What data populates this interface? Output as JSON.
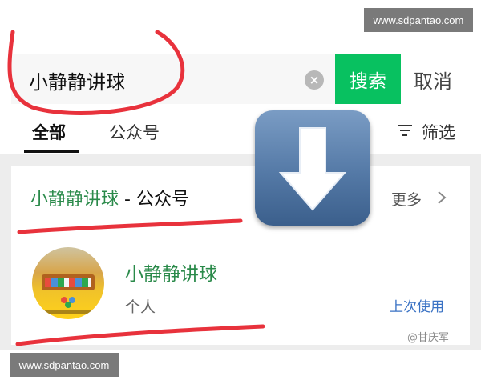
{
  "watermark": {
    "site": "www.sdpantao.com"
  },
  "search": {
    "query": "小静静讲球",
    "clear_glyph": "×",
    "button_label": "搜索",
    "cancel_label": "取消"
  },
  "tabs": {
    "all": "全部",
    "official": "公众号",
    "filter": "筛选"
  },
  "section": {
    "title_highlight": "小静静讲球",
    "title_rest": " - 公众号",
    "more": "更多"
  },
  "account": {
    "name": "小静静讲球",
    "type": "个人",
    "status": "上次使用"
  },
  "author_mark": "@甘庆军",
  "colors": {
    "accent_green": "#08c160",
    "name_green": "#2a8a4a",
    "link_blue": "#3a72c4",
    "annotation_red": "#e8323c"
  },
  "icons": {
    "clear": "close-circle-icon",
    "filter": "filter-icon",
    "more": "chevron-right-icon",
    "overlay": "down-arrow-icon"
  }
}
